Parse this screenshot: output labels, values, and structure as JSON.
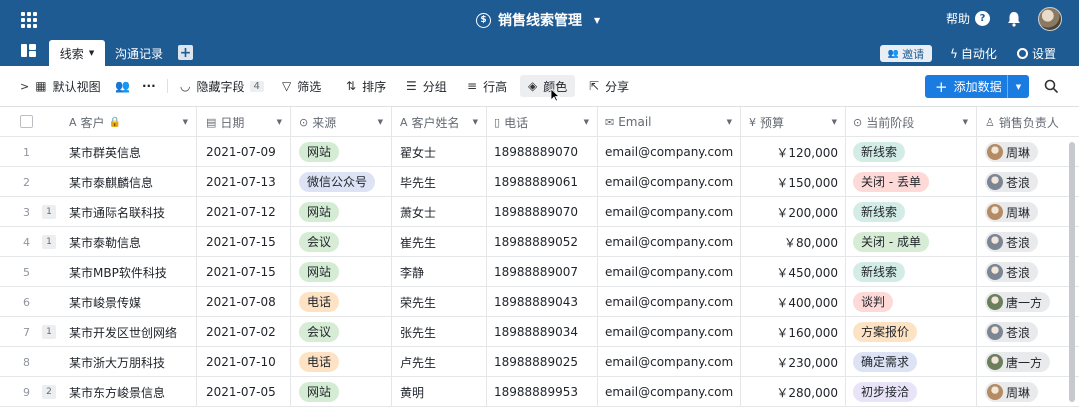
{
  "app": {
    "title": "销售线索管理",
    "help_label": "帮助"
  },
  "tabs": [
    {
      "label": "线索"
    },
    {
      "label": "沟通记录"
    }
  ],
  "header_actions": {
    "invite": "邀请",
    "automation": "自动化",
    "settings": "设置"
  },
  "toolbar": {
    "view": "默认视图",
    "hidden_fields": "隐藏字段",
    "hidden_count": "4",
    "filter": "筛选",
    "sort": "排序",
    "group": "分组",
    "row_height": "行高",
    "color": "颜色",
    "share": "分享",
    "add_data": "添加数据"
  },
  "columns": [
    "客户",
    "日期",
    "来源",
    "客户姓名",
    "电话",
    "Email",
    "预算",
    "当前阶段",
    "销售负责人"
  ],
  "source_colors": {
    "网站": "#d5ecd4",
    "微信公众号": "#dde3f5",
    "会议": "#d6ecd5",
    "电话": "#fde3c4"
  },
  "stage_colors": {
    "新线索": "#d3ede6",
    "关闭 - 丢单": "#fdd9d7",
    "关闭 - 成单": "#d6ecd5",
    "谈判": "#fdd9d7",
    "方案报价": "#fde3c4",
    "确定需求": "#dde3f5",
    "初步接洽": "#e8e3f6"
  },
  "owner_avatars": {
    "周琳": "#b58b64",
    "苍浪": "#7b8594",
    "唐一方": "#6b7f5d"
  },
  "rows": [
    {
      "idx": "1",
      "count": "",
      "customer": "某市群英信息",
      "date": "2021-07-09",
      "source": "网站",
      "name": "翟女士",
      "phone": "18988889070",
      "email": "email@company.com",
      "budget": "￥120,000",
      "stage": "新线索",
      "owner": "周琳"
    },
    {
      "idx": "2",
      "count": "",
      "customer": "某市泰麒麟信息",
      "date": "2021-07-13",
      "source": "微信公众号",
      "name": "毕先生",
      "phone": "18988889061",
      "email": "email@company.com",
      "budget": "￥150,000",
      "stage": "关闭 - 丢单",
      "owner": "苍浪"
    },
    {
      "idx": "3",
      "count": "1",
      "customer": "某市通际名联科技",
      "date": "2021-07-12",
      "source": "网站",
      "name": "萧女士",
      "phone": "18988889070",
      "email": "email@company.com",
      "budget": "￥200,000",
      "stage": "新线索",
      "owner": "周琳"
    },
    {
      "idx": "4",
      "count": "1",
      "customer": "某市泰勒信息",
      "date": "2021-07-15",
      "source": "会议",
      "name": "崔先生",
      "phone": "18988889052",
      "email": "email@company.com",
      "budget": "￥80,000",
      "stage": "关闭 - 成单",
      "owner": "苍浪"
    },
    {
      "idx": "5",
      "count": "",
      "customer": "某市MBP软件科技",
      "date": "2021-07-15",
      "source": "网站",
      "name": "李静",
      "phone": "18988889007",
      "email": "email@company.com",
      "budget": "￥450,000",
      "stage": "新线索",
      "owner": "苍浪"
    },
    {
      "idx": "6",
      "count": "",
      "customer": "某市峻景传媒",
      "date": "2021-07-08",
      "source": "电话",
      "name": "荣先生",
      "phone": "18988889043",
      "email": "email@company.com",
      "budget": "￥400,000",
      "stage": "谈判",
      "owner": "唐一方"
    },
    {
      "idx": "7",
      "count": "1",
      "customer": "某市开发区世创网络",
      "date": "2021-07-02",
      "source": "会议",
      "name": "张先生",
      "phone": "18988889034",
      "email": "email@company.com",
      "budget": "￥160,000",
      "stage": "方案报价",
      "owner": "苍浪"
    },
    {
      "idx": "8",
      "count": "",
      "customer": "某市浙大万朋科技",
      "date": "2021-07-10",
      "source": "电话",
      "name": "卢先生",
      "phone": "18988889025",
      "email": "email@company.com",
      "budget": "￥230,000",
      "stage": "确定需求",
      "owner": "唐一方"
    },
    {
      "idx": "9",
      "count": "2",
      "customer": "某市东方峻景信息",
      "date": "2021-07-05",
      "source": "网站",
      "name": "黄明",
      "phone": "18988889953",
      "email": "email@company.com",
      "budget": "￥280,000",
      "stage": "初步接洽",
      "owner": "周琳"
    }
  ]
}
